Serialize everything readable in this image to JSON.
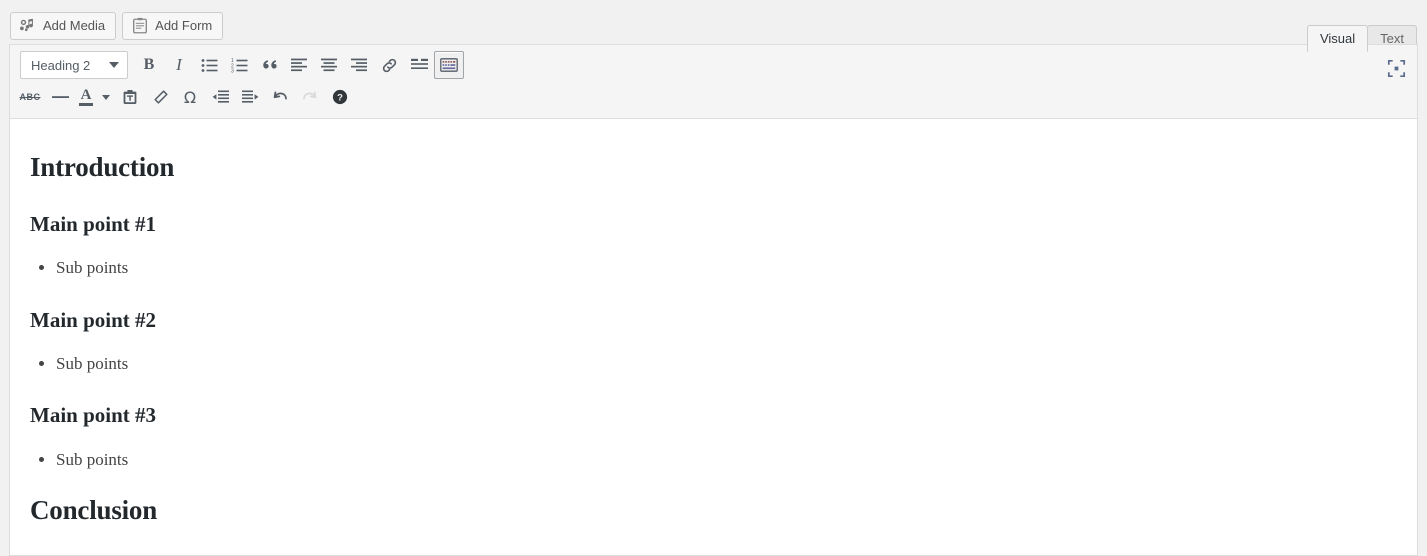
{
  "media_bar": {
    "buttons": [
      {
        "label": "Add Media",
        "icon": "admin-media-icon"
      },
      {
        "label": "Add Form",
        "icon": "form-document-icon"
      }
    ]
  },
  "editor_tabs": [
    {
      "label": "Visual",
      "active": true
    },
    {
      "label": "Text",
      "active": false
    }
  ],
  "toolbar": {
    "format_select": {
      "value": "Heading 2",
      "icon": "chevron-down-icon"
    },
    "row1": [
      {
        "name": "bold",
        "label": "B",
        "title": "Bold"
      },
      {
        "name": "italic",
        "label": "I",
        "title": "Italic"
      },
      {
        "name": "bullist",
        "label": "",
        "title": "Bulleted list"
      },
      {
        "name": "numlist",
        "label": "",
        "title": "Numbered list"
      },
      {
        "name": "blockquote",
        "label": "“",
        "title": "Blockquote"
      },
      {
        "name": "alignleft",
        "label": "",
        "title": "Align left"
      },
      {
        "name": "aligncenter",
        "label": "",
        "title": "Align center"
      },
      {
        "name": "alignright",
        "label": "",
        "title": "Align right"
      },
      {
        "name": "link",
        "label": "",
        "title": "Insert/edit link"
      },
      {
        "name": "wp_more",
        "label": "",
        "title": "Insert Read More tag"
      },
      {
        "name": "wp_adv",
        "label": "",
        "title": "Toolbar Toggle"
      }
    ],
    "row2": [
      {
        "name": "strikethrough",
        "label": "ABC",
        "title": "Strikethrough"
      },
      {
        "name": "hr",
        "label": "",
        "title": "Horizontal line"
      },
      {
        "name": "forecolor",
        "label": "A",
        "title": "Text color"
      },
      {
        "name": "pastetext",
        "label": "",
        "title": "Paste as text"
      },
      {
        "name": "removeformat",
        "label": "",
        "title": "Clear formatting"
      },
      {
        "name": "charmap",
        "label": "Ω",
        "title": "Special character"
      },
      {
        "name": "outdent",
        "label": "",
        "title": "Decrease indent"
      },
      {
        "name": "indent",
        "label": "",
        "title": "Increase indent"
      },
      {
        "name": "undo",
        "label": "",
        "title": "Undo"
      },
      {
        "name": "redo",
        "label": "",
        "title": "Redo"
      },
      {
        "name": "wp_help",
        "label": "",
        "title": "Keyboard Shortcuts"
      }
    ],
    "fullscreen": {
      "icon": "fullscreen-icon",
      "title": "Distraction-free writing mode"
    }
  },
  "content": {
    "blocks": [
      {
        "type": "h2",
        "text": "Introduction"
      },
      {
        "type": "h3",
        "text": "Main point #1"
      },
      {
        "type": "ul",
        "items": [
          "Sub points"
        ]
      },
      {
        "type": "h3",
        "text": "Main point #2"
      },
      {
        "type": "ul",
        "items": [
          "Sub points"
        ]
      },
      {
        "type": "h3",
        "text": "Main point #3"
      },
      {
        "type": "ul",
        "items": [
          "Sub points"
        ]
      },
      {
        "type": "h2",
        "text": "Conclusion"
      }
    ]
  },
  "colors": {
    "page_bg": "#f1f1f1",
    "toolbar_bg": "#f5f5f5",
    "canvas_bg": "#ffffff",
    "icon": "#555d66",
    "heading": "#23282d",
    "border": "#dddddd"
  }
}
